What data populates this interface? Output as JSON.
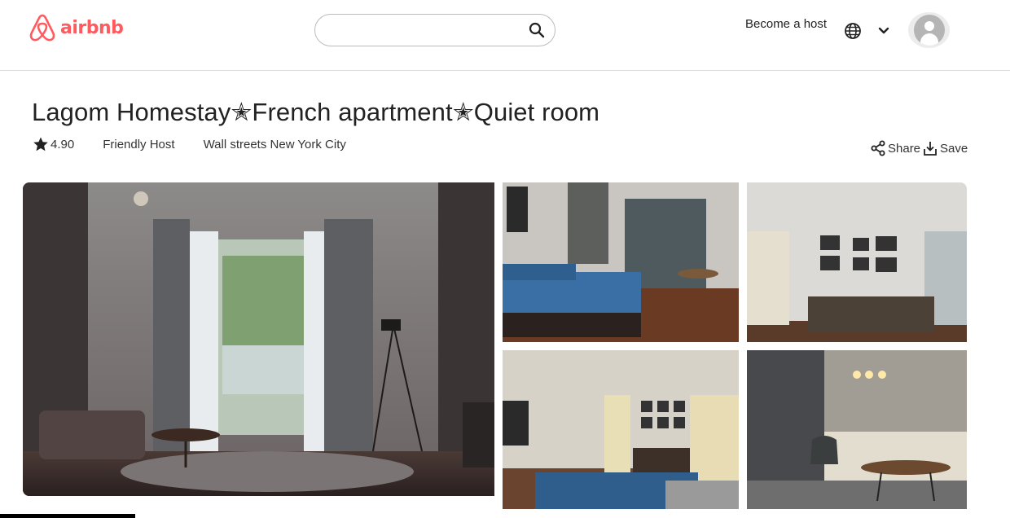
{
  "header": {
    "logo_text": "airbnb",
    "search": {
      "value": "",
      "placeholder": ""
    },
    "become_host": "Become a host",
    "icons": [
      "airbnb-logo-icon",
      "search-icon",
      "globe-icon",
      "chevron-down-icon",
      "user-avatar-icon"
    ]
  },
  "listing": {
    "title": "Lagom Homestay✭French apartment✭Quiet room",
    "rating": "4.90",
    "host_label": "Friendly Host",
    "location": "Wall streets New York City",
    "share_label": "Share",
    "save_label": "Save"
  },
  "gallery": {
    "photos": [
      {
        "name": "main",
        "subject": "bedroom with balcony doors"
      },
      {
        "name": "top-left",
        "subject": "bedroom with blue bed"
      },
      {
        "name": "top-right",
        "subject": "room with dresser and frames"
      },
      {
        "name": "bottom-left",
        "subject": "room with deer picture"
      },
      {
        "name": "bottom-right",
        "subject": "corner with chair and table"
      }
    ]
  },
  "colors": {
    "brand": "#ff5a5f",
    "text": "#222222",
    "border": "#dddddd"
  }
}
